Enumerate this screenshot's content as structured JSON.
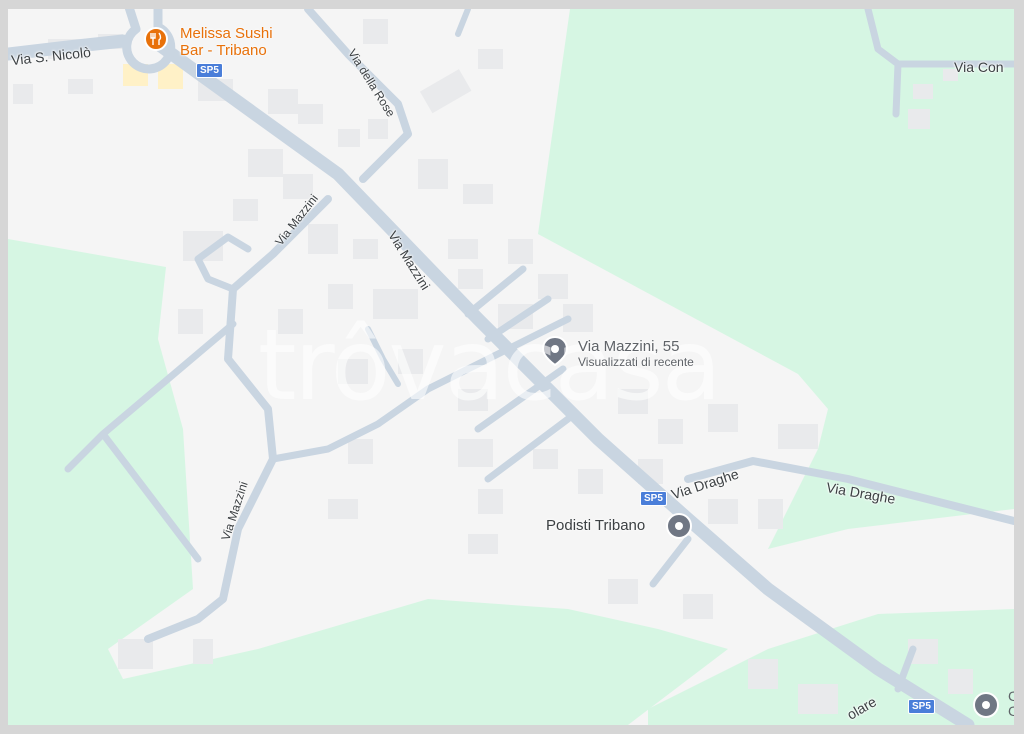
{
  "map": {
    "colors": {
      "land": "#f5f5f5",
      "park": "#d6f6e3",
      "road": "#c9d5e1",
      "building": "#e9eaec",
      "accent_poi": "#e8710a",
      "pin": "#707784"
    },
    "watermark": "trôvacasa",
    "streets": {
      "via_s_nicolo": "Via S. Nicolò",
      "via_della_rose": "Via della Rose",
      "via_mazzini_main": "Via Mazzini",
      "via_mazzini_west": "Via Mazzini",
      "via_mazzini_south": "Via Mazzini",
      "via_draghe_1": "Via Draghe",
      "via_draghe_2": "Via Draghe",
      "via_con": "Via Con",
      "via_olare": "olare"
    },
    "shields": {
      "sp5_north": "SP5",
      "sp5_mid": "SP5",
      "sp5_south": "SP5"
    },
    "pois": {
      "restaurant": {
        "line1": "Melissa Sushi",
        "line2": "Bar - Tribano",
        "icon": "fork-knife-icon"
      },
      "selected": {
        "title": "Via Mazzini, 55",
        "subtitle": "Visualizzati di recente",
        "icon": "location-pin-icon"
      },
      "podisti": {
        "title": "Podisti Tribano",
        "icon": "location-pin-icon"
      },
      "corner": {
        "title": "C",
        "subtitle": "C",
        "icon": "location-pin-icon"
      }
    }
  }
}
